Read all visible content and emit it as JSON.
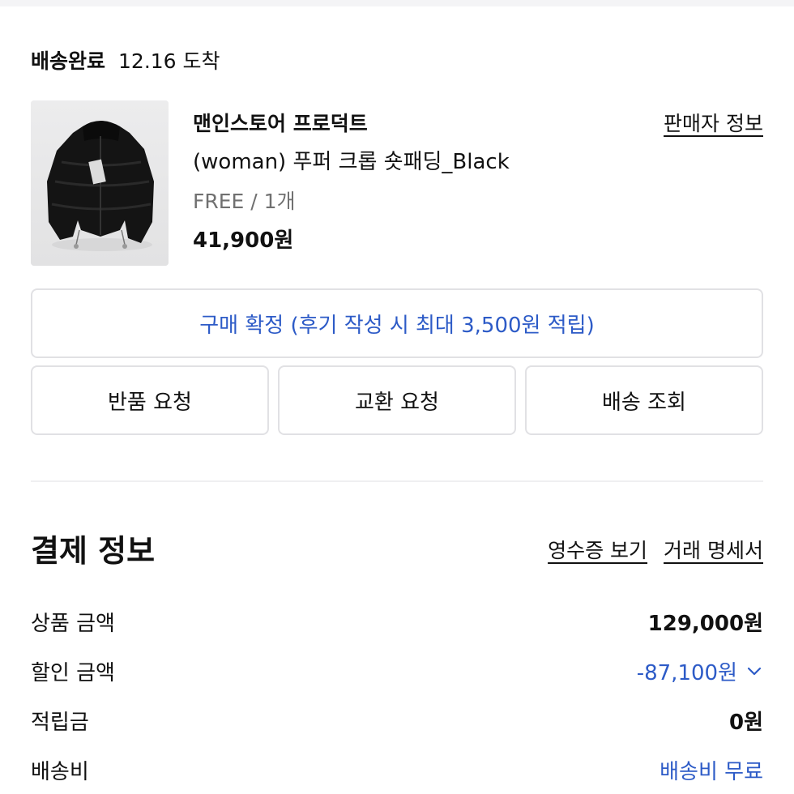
{
  "order": {
    "status_label": "배송완료",
    "arrival_text": "12.16 도착"
  },
  "product": {
    "image_icon": "black-cropped-puffer-jacket-image",
    "brand": "맨인스토어 프로덕트",
    "name": "(woman) 푸퍼 크롭 숏패딩_Black",
    "option": "FREE / 1개",
    "price": "41,900원",
    "seller_link": "판매자 정보"
  },
  "actions": {
    "confirm_label": "구매 확정 (후기 작성 시 최대 3,500원 적립)",
    "return_label": "반품 요청",
    "exchange_label": "교환 요청",
    "tracking_label": "배송 조회"
  },
  "payment": {
    "title": "결제 정보",
    "receipt_link": "영수증 보기",
    "statement_link": "거래 명세서",
    "rows": [
      {
        "label": "상품 금액",
        "value": "129,000원"
      },
      {
        "label": "할인 금액",
        "value": "-87,100원"
      },
      {
        "label": "적립금",
        "value": "0원"
      },
      {
        "label": "배송비",
        "value": "배송비 무료"
      }
    ]
  },
  "colors": {
    "accent_blue": "#2d5bc7",
    "border": "#e1e1e4",
    "muted_text": "#707070"
  }
}
